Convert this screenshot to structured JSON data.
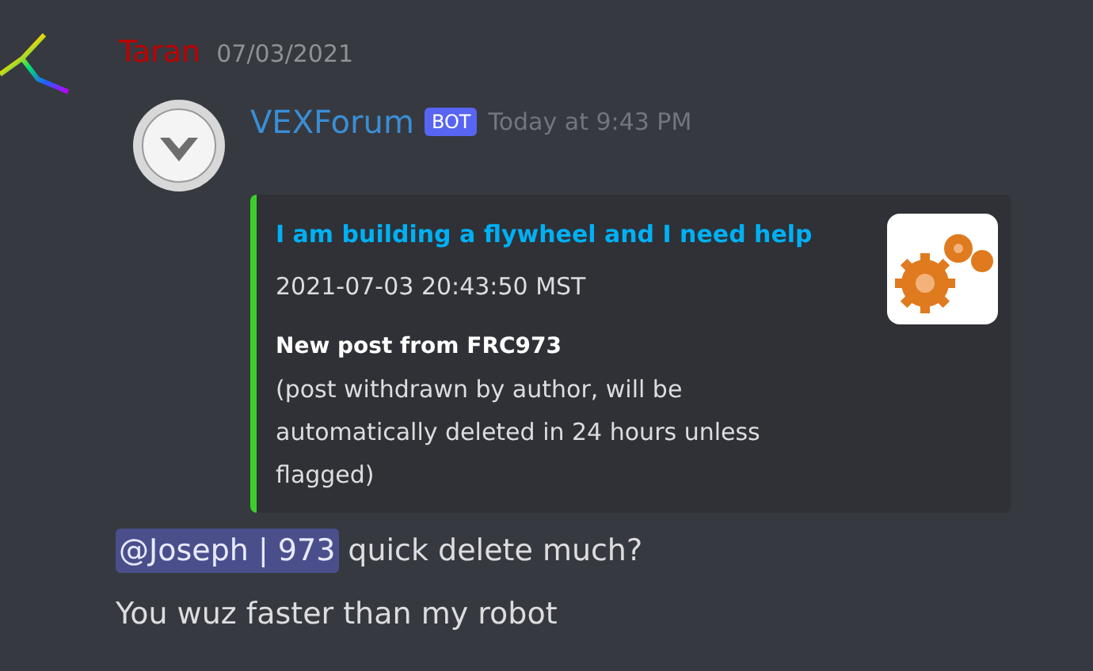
{
  "message": {
    "author": "Taran",
    "timestamp": "07/03/2021",
    "quoted": {
      "author": "VEXForum",
      "tag": "BOT",
      "timestamp": "Today at 9:43 PM",
      "embed": {
        "title": "I am building a flywheel and I need help",
        "date": "2021-07-03 20:43:50 MST",
        "heading": "New post from FRC973",
        "description": "(post withdrawn by author, will be automatically deleted in 24 hours unless flagged)"
      }
    },
    "lines": [
      {
        "mention": "@Joseph | 973",
        "text": "quick delete much?"
      },
      {
        "text": "You wuz faster than my robot"
      }
    ]
  }
}
